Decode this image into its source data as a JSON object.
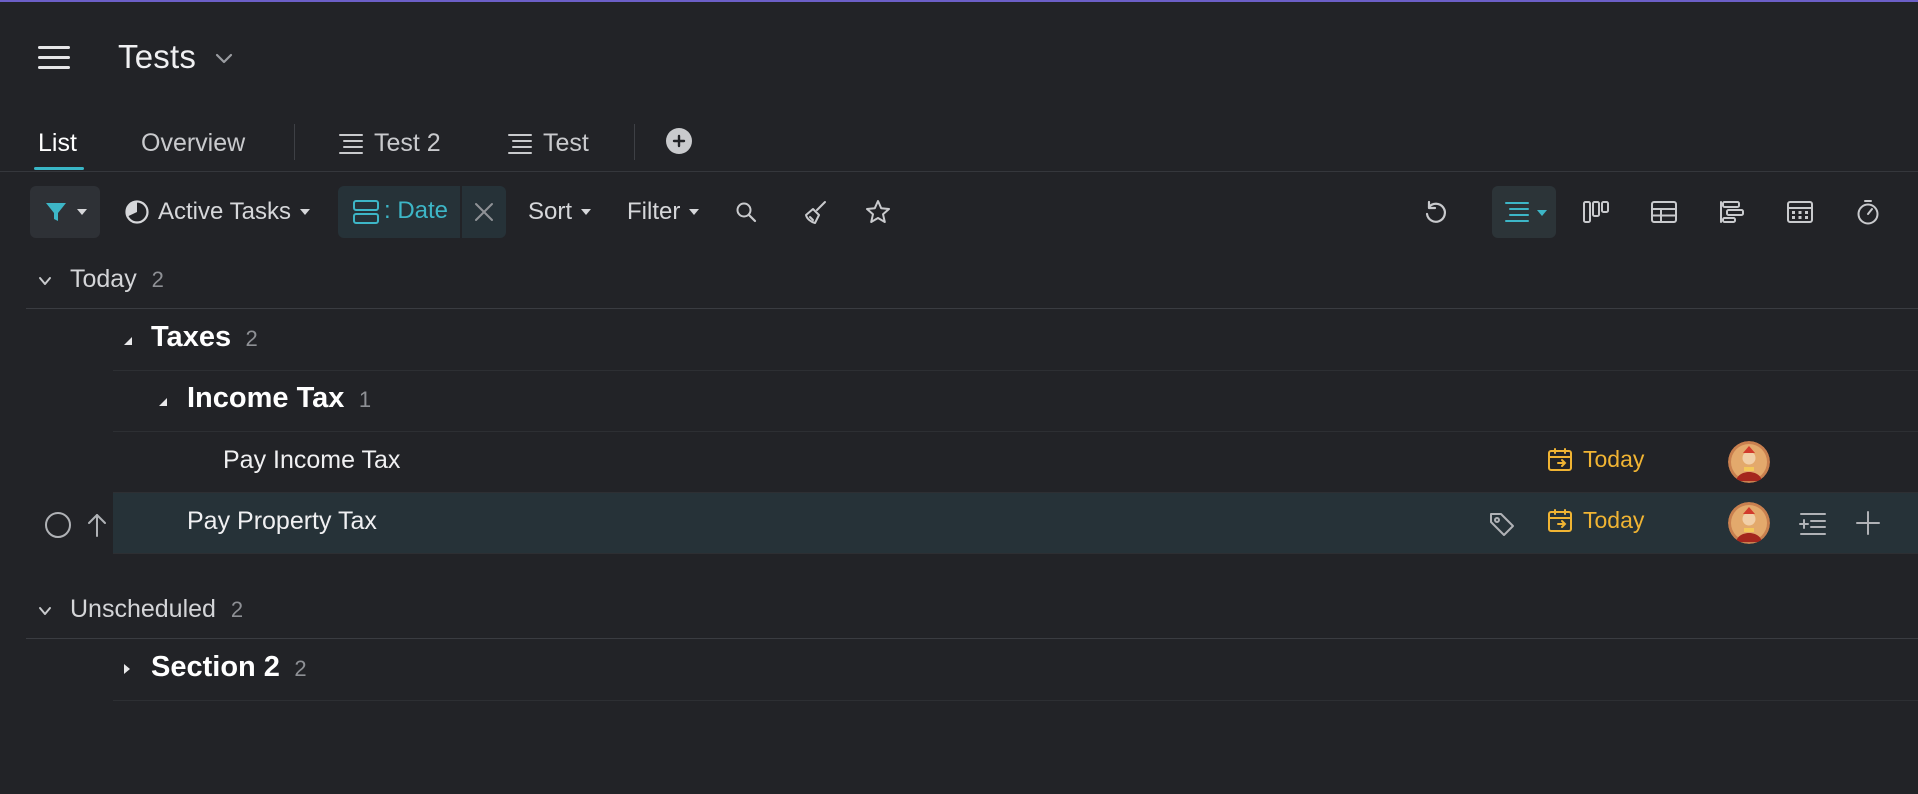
{
  "colors": {
    "accent": "#3db6c7",
    "due_today": "#f0b433",
    "highlight_row": "#263238",
    "top_line": "#6c5fc7"
  },
  "header": {
    "title": "Tests"
  },
  "tabs": [
    {
      "label": "List",
      "active": true
    },
    {
      "label": "Overview"
    },
    {
      "label": "Test 2",
      "icon": "list-view-icon"
    },
    {
      "label": "Test",
      "icon": "list-view-icon"
    }
  ],
  "toolbar": {
    "active_tasks_label": "Active Tasks",
    "group_chip_label": ": Date",
    "sort_label": "Sort",
    "filter_label": "Filter"
  },
  "sections": [
    {
      "label": "Today",
      "count": "2",
      "groups": [
        {
          "label": "Taxes",
          "count": "2"
        },
        {
          "label": "Income Tax",
          "count": "1"
        }
      ],
      "tasks": [
        {
          "label": "Pay Income Tax",
          "due": "Today"
        },
        {
          "label": "Pay Property Tax",
          "due": "Today"
        }
      ]
    },
    {
      "label": "Unscheduled",
      "count": "2",
      "groups": [
        {
          "label": "Section 2",
          "count": "2"
        }
      ]
    }
  ]
}
